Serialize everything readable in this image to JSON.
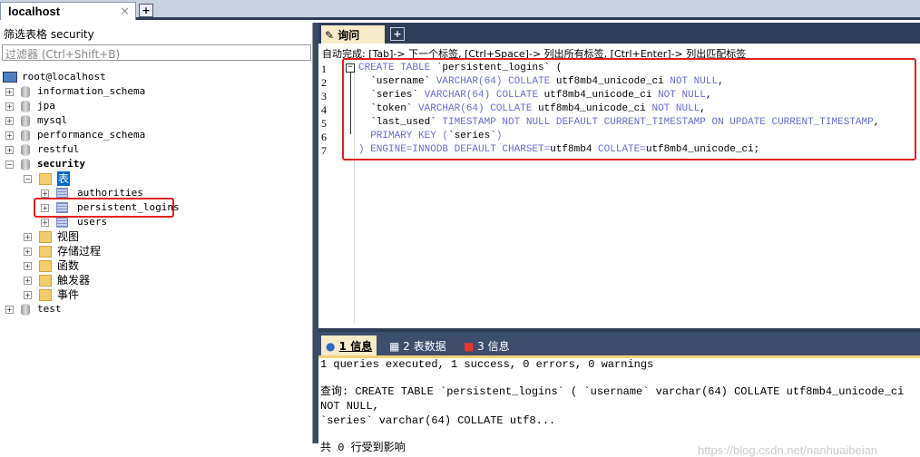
{
  "connection_tab": {
    "label": "localhost",
    "close": "✕",
    "add": "+"
  },
  "sidebar": {
    "filter_label": "筛选表格 security",
    "filter_placeholder": "过滤器 (Ctrl+Shift+B)",
    "root": "root@localhost",
    "databases": [
      "information_schema",
      "jpa",
      "mysql",
      "performance_schema",
      "restful"
    ],
    "security": "security",
    "tables_folder": "表",
    "tables": [
      "authorities",
      "persistent_logins",
      "users"
    ],
    "folders": [
      "视图",
      "存储过程",
      "函数",
      "触发器",
      "事件"
    ],
    "last_db": "test"
  },
  "query": {
    "tab_label": "询问",
    "add": "+",
    "hint": "自动完成: [Tab]-> 下一个标签, [Ctrl+Space]-> 列出所有标签, [Ctrl+Enter]-> 列出匹配标签",
    "line_numbers": [
      "1",
      "2",
      "3",
      "4",
      "5",
      "6",
      "7"
    ],
    "lines": [
      [
        [
          "CREATE TABLE ",
          "kw"
        ],
        [
          "`persistent_logins` (",
          "id"
        ]
      ],
      [
        [
          "  `username` ",
          "id"
        ],
        [
          "VARCHAR(64) COLLATE ",
          "kw"
        ],
        [
          "utf8mb4_unicode_ci ",
          "id"
        ],
        [
          "NOT NULL",
          "kw"
        ],
        [
          ",",
          "id"
        ]
      ],
      [
        [
          "  `series` ",
          "id"
        ],
        [
          "VARCHAR(64) COLLATE ",
          "kw"
        ],
        [
          "utf8mb4_unicode_ci ",
          "id"
        ],
        [
          "NOT NULL",
          "kw"
        ],
        [
          ",",
          "id"
        ]
      ],
      [
        [
          "  `token` ",
          "id"
        ],
        [
          "VARCHAR(64) COLLATE ",
          "kw"
        ],
        [
          "utf8mb4_unicode_ci ",
          "id"
        ],
        [
          "NOT NULL",
          "kw"
        ],
        [
          ",",
          "id"
        ]
      ],
      [
        [
          "  `last_used` ",
          "id"
        ],
        [
          "TIMESTAMP NOT NULL DEFAULT CURRENT_TIMESTAMP ON UPDATE CURRENT_TIMESTAMP",
          "kw"
        ],
        [
          ",",
          "id"
        ]
      ],
      [
        [
          "  PRIMARY KEY (",
          "kw"
        ],
        [
          "`series`",
          "id"
        ],
        [
          ")",
          "kw"
        ]
      ],
      [
        [
          ") ENGINE=INNODB DEFAULT CHARSET=",
          "kw"
        ],
        [
          "utf8mb4 ",
          "id"
        ],
        [
          "COLLATE=",
          "kw"
        ],
        [
          "utf8mb4_unicode_ci;",
          "id"
        ]
      ]
    ]
  },
  "output": {
    "tabs": [
      "1 信息",
      "2 表数据",
      "3 信息"
    ],
    "summary": "1 queries executed, 1 success, 0 errors, 0 warnings",
    "query_line1": "查询: CREATE TABLE `persistent_logins` ( `username` varchar(64) COLLATE utf8mb4_unicode_ci NOT NULL,",
    "query_line2": "`series` varchar(64) COLLATE utf8...",
    "affected": "共 0 行受到影响",
    "watermark": "https://blog.csdn.net/nanhuaibeian"
  }
}
